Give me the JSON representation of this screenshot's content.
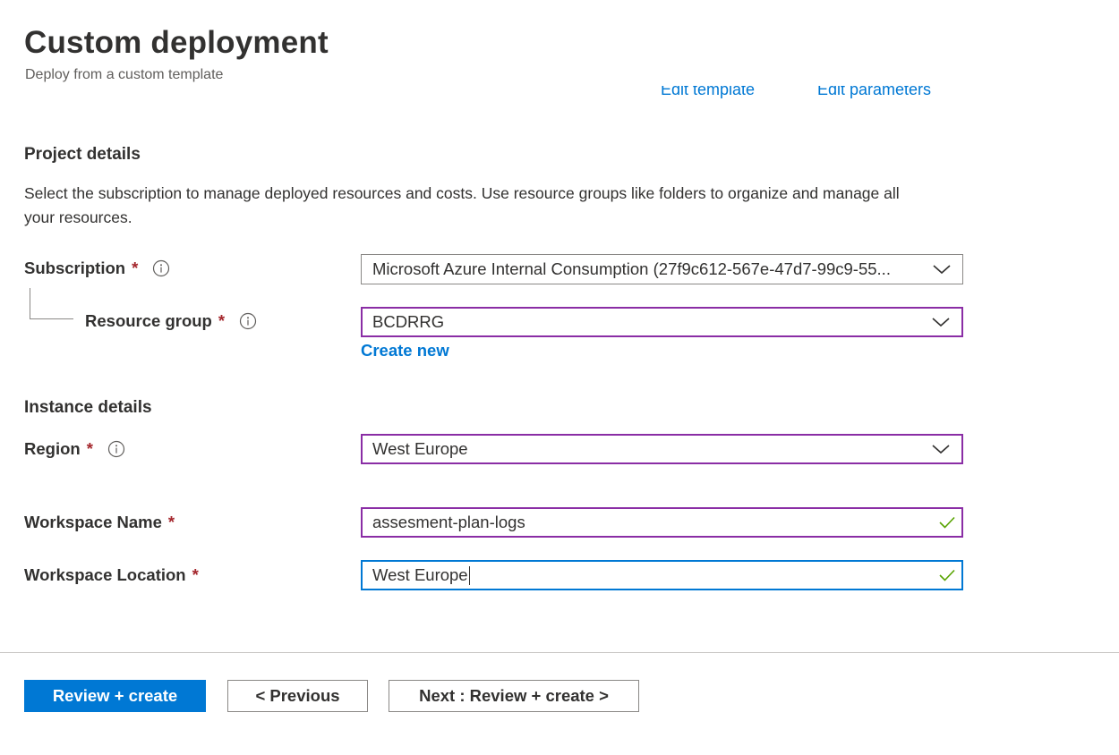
{
  "header": {
    "title": "Custom deployment",
    "subtitle": "Deploy from a custom template"
  },
  "template_links": {
    "edit_template": "Edit template",
    "edit_parameters": "Edit parameters"
  },
  "project_details": {
    "heading": "Project details",
    "description": "Select the subscription to manage deployed resources and costs. Use resource groups like folders to organize and manage all your resources.",
    "subscription": {
      "label": "Subscription",
      "required_mark": "*",
      "value": "Microsoft Azure Internal Consumption (27f9c612-567e-47d7-99c9-55..."
    },
    "resource_group": {
      "label": "Resource group",
      "required_mark": "*",
      "value": "BCDRRG",
      "create_new": "Create new"
    }
  },
  "instance_details": {
    "heading": "Instance details",
    "region": {
      "label": "Region",
      "required_mark": "*",
      "value": "West Europe"
    },
    "workspace_name": {
      "label": "Workspace Name",
      "required_mark": "*",
      "value": "assesment-plan-logs"
    },
    "workspace_location": {
      "label": "Workspace Location",
      "required_mark": "*",
      "value": "West Europe"
    }
  },
  "footer": {
    "review_create": "Review + create",
    "previous": "< Previous",
    "next": "Next : Review + create >"
  },
  "colors": {
    "accent": "#0078d4",
    "required": "#a4262c",
    "dirty_border": "#8a2da5",
    "valid_check": "#57a300"
  }
}
